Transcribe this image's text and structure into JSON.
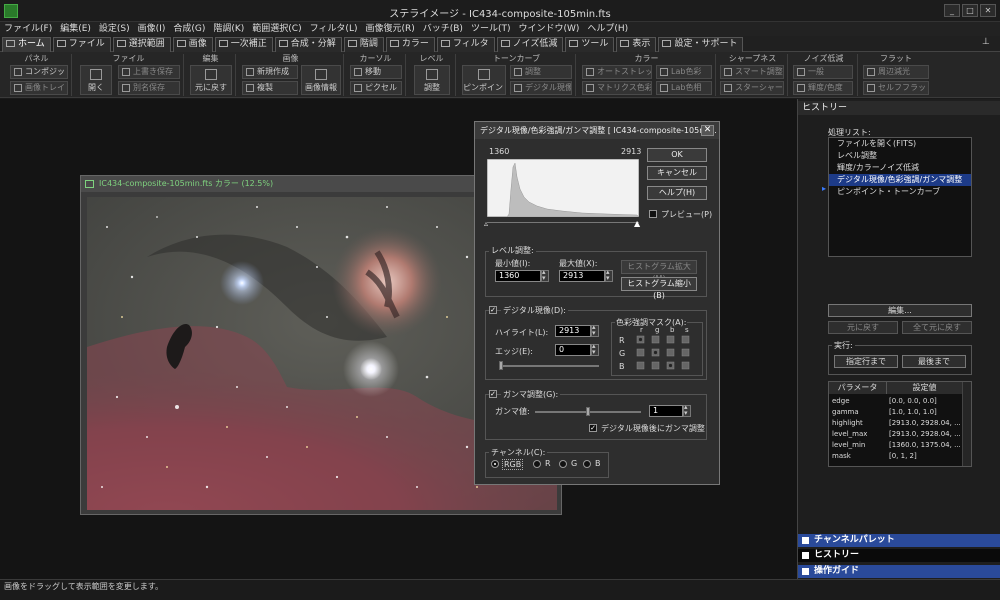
{
  "window": {
    "title": "ステライメージ - IC434-composite-105min.fts",
    "min": "_",
    "max": "□",
    "close": "✕"
  },
  "menu": [
    "ファイル(F)",
    "編集(E)",
    "設定(S)",
    "画像(I)",
    "合成(G)",
    "階調(K)",
    "範囲選択(C)",
    "フィルタ(L)",
    "画像復元(R)",
    "バッチ(B)",
    "ツール(T)",
    "ウインドウ(W)",
    "ヘルプ(H)"
  ],
  "tabs": [
    {
      "label": "ホーム",
      "active": true
    },
    {
      "label": "ファイル"
    },
    {
      "label": "選択範囲"
    },
    {
      "label": "画像"
    },
    {
      "label": "一次補正"
    },
    {
      "label": "合成・分解"
    },
    {
      "label": "階調"
    },
    {
      "label": "カラー"
    },
    {
      "label": "フィルタ"
    },
    {
      "label": "ノイズ低減"
    },
    {
      "label": "ツール"
    },
    {
      "label": "表示"
    },
    {
      "label": "設定・サポート"
    }
  ],
  "pin": "⊥",
  "ribbon": {
    "panel": {
      "title": "パネル",
      "composite": "コンポジット",
      "image_tray": "画像トレイ"
    },
    "file": {
      "title": "ファイル",
      "open": "開く",
      "overwrite": "上書き保存",
      "save_as": "別名保存"
    },
    "edit": {
      "title": "編集",
      "undo": "元に戻す"
    },
    "image": {
      "title": "画像",
      "new": "新規作成",
      "duplicate": "複製",
      "info": "画像情報"
    },
    "cursor": {
      "title": "カーソル",
      "move": "移動",
      "pixel": "ピクセル"
    },
    "level": {
      "title": "レベル",
      "adjust": "調整"
    },
    "tone": {
      "title": "トーンカーブ",
      "pinpoint": "ピンポイント",
      "adjust": "調整",
      "digital": "デジタル現像"
    },
    "color": {
      "title": "カラー",
      "auto_stretch": "オートストレッチ",
      "matrix": "マトリクス色彩",
      "lab_color": "Lab色彩",
      "lab_hue": "Lab色相"
    },
    "sharpness": {
      "title": "シャープネス",
      "smart": "スマート調整",
      "star_sharp": "スターシャープ"
    },
    "noise": {
      "title": "ノイズ低減",
      "general": "一般",
      "luma_color": "輝度/色度"
    },
    "flat": {
      "title": "フラット",
      "vignette": "周辺減光",
      "self_flat": "セルフフラット"
    }
  },
  "image_window": {
    "title": "IC434-composite-105min.fts カラー (12.5%)"
  },
  "dialog": {
    "title": "デジタル現像/色彩強調/ガンマ調整 [ IC434-composite-105min.",
    "close": "✕",
    "hist_min": "1360",
    "hist_max": "2913",
    "ok": "OK",
    "cancel": "キャンセル",
    "help": "ヘルプ(H)",
    "preview": "プレビュー(P)",
    "level_group": "レベル調整:",
    "min_label": "最小値(I):",
    "min_value": "1360",
    "max_label": "最大値(X):",
    "max_value": "2913",
    "hist_expand": "ヒストグラム拡大(M)",
    "hist_shrink": "ヒストグラム縮小(B)",
    "digital_group": "デジタル現像(D):",
    "highlight_label": "ハイライト(L):",
    "highlight_value": "2913",
    "edge_label": "エッジ(E):",
    "edge_value": "0",
    "mask_title": "色彩強調マスク(A):",
    "mask_cols": [
      "r",
      "g",
      "b",
      "s"
    ],
    "mask_rows": [
      "R",
      "G",
      "B"
    ],
    "gamma_group": "ガンマ調整(G):",
    "gamma_label": "ガンマ値:",
    "gamma_value": "1",
    "gamma_after": "デジタル現像後にガンマ調整",
    "channel_group": "チャンネル(C):",
    "channels": [
      "RGB",
      "R",
      "G",
      "B"
    ],
    "channel_selected": "RGB"
  },
  "history_panel": {
    "title": "ヒストリー",
    "list_label": "処理リスト:",
    "items": [
      "ファイルを開く(FITS)",
      "レベル調整",
      "輝度/カラーノイズ低減",
      "デジタル現像/色彩強調/ガンマ調整",
      "ピンポイント・トーンカーブ"
    ],
    "selected_index": 3,
    "edit": "編集...",
    "undo": "元に戻す",
    "undo_all": "全て元に戻す",
    "run_label": "実行:",
    "run_to": "指定行まで",
    "run_last": "最後まで",
    "table_headers": [
      "パラメータ",
      "設定値"
    ],
    "params": [
      {
        "name": "edge",
        "value": "[0.0, 0.0, 0.0]"
      },
      {
        "name": "gamma",
        "value": "[1.0, 1.0, 1.0]"
      },
      {
        "name": "highlight",
        "value": "[2913.0, 2928.04, ..."
      },
      {
        "name": "level_max",
        "value": "[2913.0, 2928.04, ..."
      },
      {
        "name": "level_min",
        "value": "[1360.0, 1375.04, ..."
      },
      {
        "name": "mask",
        "value": "[0, 1, 2]"
      }
    ]
  },
  "bottom_panels": [
    "チャンネルパレット",
    "ヒストリー",
    "操作ガイド"
  ],
  "status": "画像をドラッグして表示範囲を変更します。",
  "colors": {
    "accent": "#1d3b88",
    "panel_blue": "#2a4a9a",
    "dark_bar": "#0a0a0a",
    "title_green": "#7fd27f"
  }
}
